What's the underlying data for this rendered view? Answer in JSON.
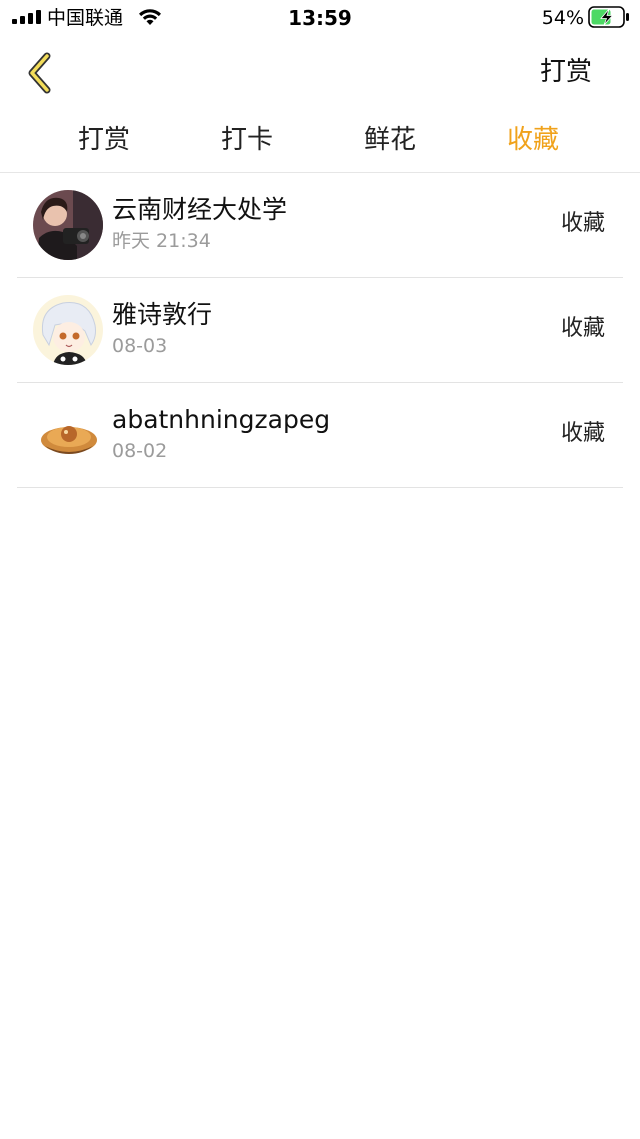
{
  "status_bar": {
    "carrier": "中国联通",
    "time": "13:59",
    "battery": "54%"
  },
  "nav": {
    "back_icon": "chevron-left-icon",
    "right_label": "打赏",
    "accent_color": "#F0A21B"
  },
  "tabs": [
    {
      "label": "打赏",
      "active": false
    },
    {
      "label": "打卡",
      "active": false
    },
    {
      "label": "鲜花",
      "active": false
    },
    {
      "label": "收藏",
      "active": true
    }
  ],
  "records": [
    {
      "name": "云南财经大处学",
      "time": "昨天 21:34",
      "action": "收藏",
      "avatar": "photo-avatar"
    },
    {
      "name": "雅诗敦行",
      "time": "08-03",
      "action": "收藏",
      "avatar": "anime-avatar"
    },
    {
      "name": "abatnhningzapeg",
      "time": "08-02",
      "action": "收藏",
      "avatar": "food-avatar"
    }
  ]
}
